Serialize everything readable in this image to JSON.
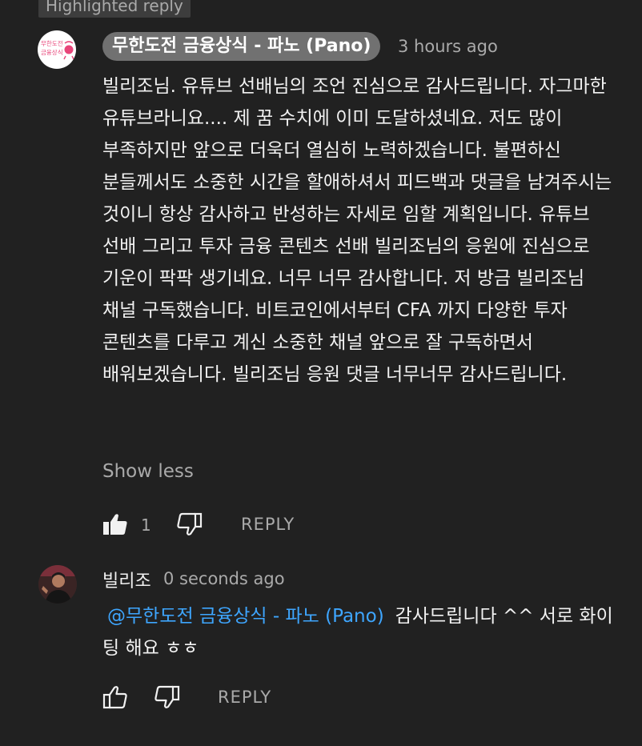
{
  "highlight_badge": "Highlighted reply",
  "comment": {
    "author": "무한도전 금융상식 - 파노 (Pano)",
    "time": "3 hours ago",
    "avatar_text_top": "무한도전",
    "avatar_text_bottom": "금융상식",
    "text": "빌리조님. 유튜브 선배님의 조언 진심으로 감사드립니다. 자그마한 유튜브라니요.... 제 꿈 수치에 이미 도달하셨네요. 저도 많이 부족하지만 앞으로 더욱더 열심히 노력하겠습니다. 불편하신 분들께서도 소중한 시간을 할애하셔서 피드백과 댓글을 남겨주시는 것이니 항상 감사하고 반성하는 자세로 임할 계획입니다. 유튜브 선배 그리고 투자 금융 콘텐츠 선배 빌리조님의 응원에 진심으로 기운이 팍팍 생기네요. 너무 너무 감사합니다. 저 방금 빌리조님 채널 구독했습니다. 비트코인에서부터 CFA 까지 다양한 투자 콘텐츠를 다루고 계신 소중한 채널 앞으로 잘 구독하면서 배워보겠습니다. 빌리조님 응원 댓글 너무너무 감사드립니다.",
    "show_less": "Show less",
    "likes": "1",
    "reply_label": "REPLY"
  },
  "reply": {
    "author": "빌리조",
    "time": "0 seconds ago",
    "mention": "@무한도전 금융상식 - 파노 (Pano)",
    "text": "감사드립니다 ^^ 서로 화이팅 해요 ㅎㅎ",
    "reply_label": "REPLY"
  },
  "icons": [
    "thumbs-up-filled-icon",
    "thumbs-down-icon",
    "thumbs-up-outline-icon"
  ],
  "colors": {
    "background": "#212121",
    "mention": "#3ea6ff",
    "secondary_text": "#aaaaaa",
    "author_chip": "#717171",
    "avatar_accent": "#e8457a"
  }
}
